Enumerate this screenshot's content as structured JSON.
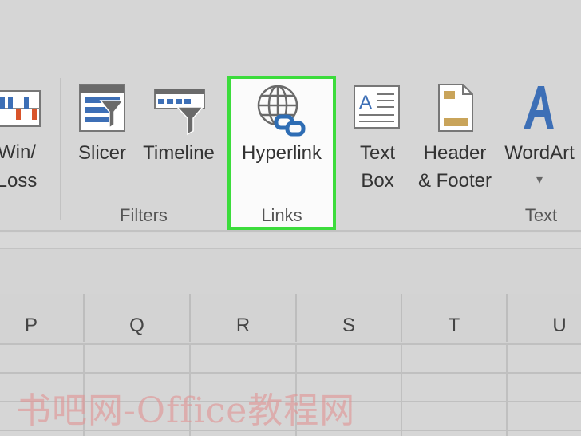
{
  "ribbon": {
    "winloss": {
      "line1": "Win/",
      "line2": "Loss"
    },
    "filters": {
      "slicer_label": "Slicer",
      "timeline_label": "Timeline",
      "group_label": "Filters"
    },
    "links": {
      "hyperlink_label": "Hyperlink",
      "group_label": "Links"
    },
    "text": {
      "textbox_line1": "Text",
      "textbox_line2": "Box",
      "header_line1": "Header",
      "header_line2": "& Footer",
      "wordart_label": "WordArt",
      "wordart_caret": "▾",
      "group_label": "Text"
    }
  },
  "columns": [
    "P",
    "Q",
    "R",
    "S",
    "T",
    "U"
  ],
  "watermark": "书吧网-Office教程网",
  "colors": {
    "highlight": "#3cdc3c",
    "accent_blue": "#3d6fb6",
    "sparkline_red": "#d9542a"
  }
}
